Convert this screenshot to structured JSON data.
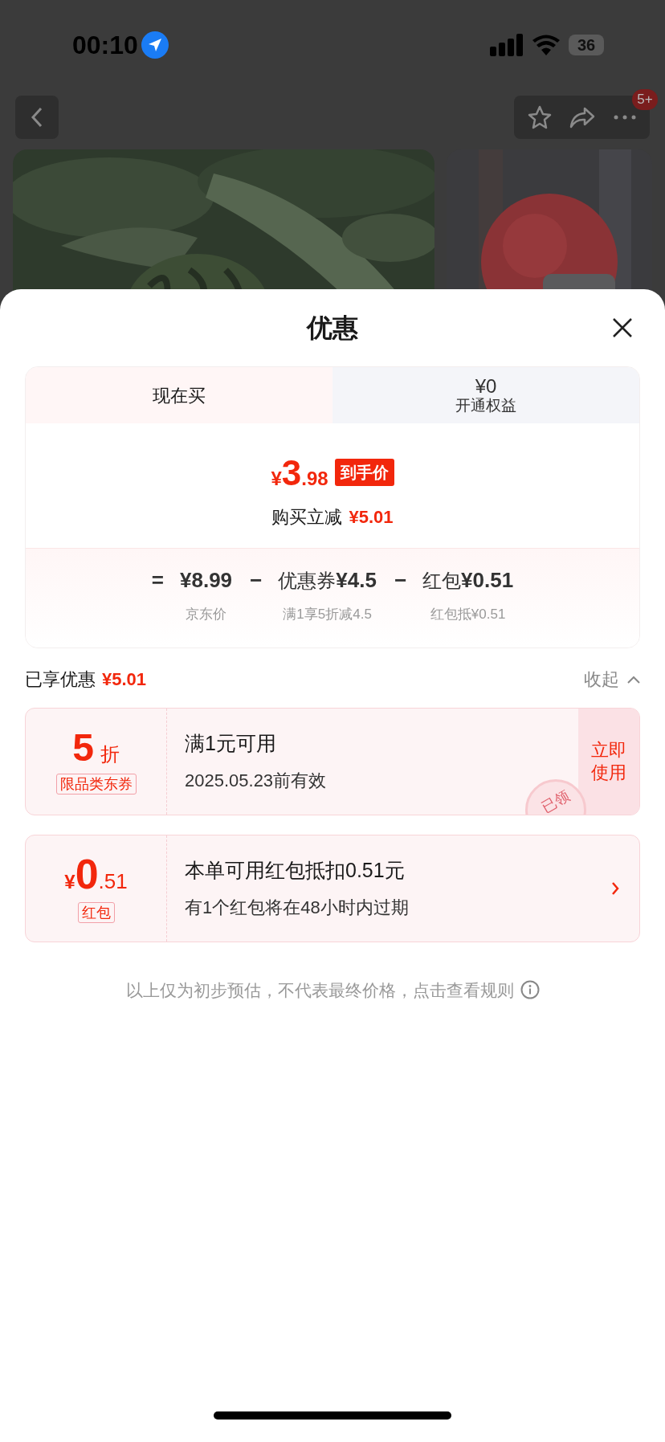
{
  "status_bar": {
    "time": "00:10",
    "battery": "36"
  },
  "nav": {
    "badge": "5+"
  },
  "sheet": {
    "title": "优惠"
  },
  "tabs": [
    {
      "label": "现在买",
      "selected": true
    },
    {
      "price": "¥0",
      "label": "开通权益",
      "selected": false
    }
  ],
  "price": {
    "currency": "¥",
    "integer": "3",
    "decimal": ".98",
    "tag": "到手价",
    "savings_label": "购买立减",
    "savings": "¥5.01"
  },
  "breakdown": [
    {
      "op": "=",
      "amount": "¥8.99",
      "note": "京东价"
    },
    {
      "op": "−",
      "label": "优惠券",
      "amount": "¥4.5",
      "note": "满1享5折减4.5"
    },
    {
      "op": "−",
      "label": "红包",
      "amount": "¥0.51",
      "note": "红包抵¥0.51"
    }
  ],
  "summary": {
    "label": "已享优惠",
    "amount": "¥5.01",
    "toggle": "收起",
    "expanded": true
  },
  "coupons": [
    {
      "kind": "discount",
      "value": "5",
      "unit": "折",
      "tag": "限品类东券",
      "title": "满1元可用",
      "subtitle": "2025.05.23前有效",
      "action": "立即使用",
      "stamp": "已领"
    },
    {
      "kind": "redpacket",
      "currency": "¥",
      "value": "0",
      "decimal": ".51",
      "tag": "红包",
      "title": "本单可用红包抵扣0.51元",
      "subtitle": "有1个红包将在48小时内过期"
    }
  ],
  "footer": "以上仅为初步预估，不代表最终价格，点击查看规则"
}
